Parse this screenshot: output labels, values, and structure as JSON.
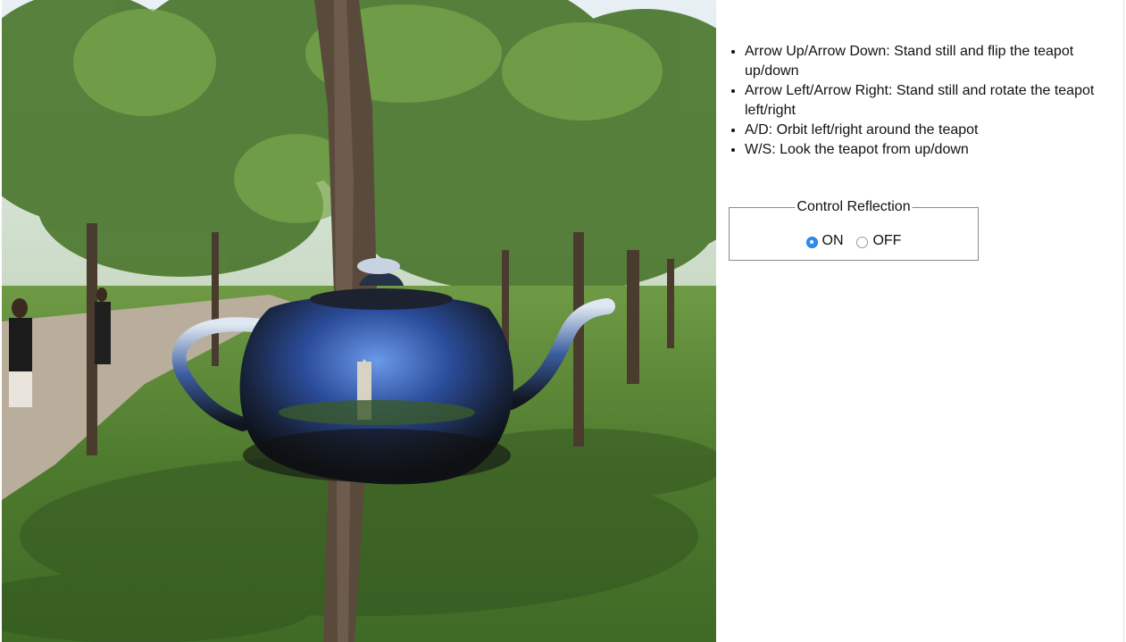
{
  "scene": {
    "description_icon": "teapot-icon",
    "colors": {
      "sky": "#dce9f2",
      "grass": "#5d8a3a",
      "path": "#b9ae9b",
      "trunk": "#5a4a3c",
      "teapot_chrome": "#2a3a6a"
    }
  },
  "controls": {
    "items": [
      {
        "label": "Arrow Up/Arrow Down: Stand still and flip the teapot up/down"
      },
      {
        "label": "Arrow Left/Arrow Right: Stand still and rotate the teapot left/right"
      },
      {
        "label": "A/D: Orbit left/right around the teapot"
      },
      {
        "label": "W/S: Look the teapot from up/down"
      }
    ]
  },
  "reflection": {
    "legend": "Control Reflection",
    "options": [
      {
        "label": "ON",
        "checked": true
      },
      {
        "label": "OFF",
        "checked": false
      }
    ],
    "accent_color": "#2d8ef0"
  }
}
